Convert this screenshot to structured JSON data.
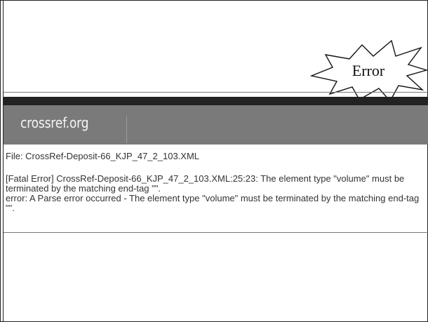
{
  "badge": {
    "text": "Error"
  },
  "header": {
    "logo_text": "crossref.org"
  },
  "content": {
    "file_line": "File: CrossRef-Deposit-66_KJP_47_2_103.XML",
    "fatal_error": "[Fatal Error] CrossRef-Deposit-66_KJP_47_2_103.XML:25:23: The element type \"volume\" must be terminated by the matching end-tag \"\".",
    "parse_error": "error: A Parse error occurred - The element type \"volume\" must be terminated by the matching end-tag \"\"."
  },
  "colors": {
    "header_band": "#222222",
    "header_bar": "#7a7a7a",
    "logo_text": "#f5f5f5",
    "body_text": "#333333"
  }
}
